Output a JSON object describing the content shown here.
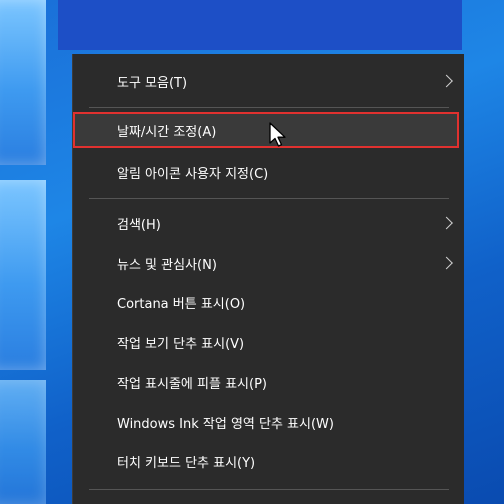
{
  "context_menu": {
    "items": [
      {
        "label": "도구 모음(T)",
        "has_submenu": true
      },
      {
        "label": "날짜/시간 조정(A)",
        "highlighted": true
      },
      {
        "label": "알림 아이콘 사용자 지정(C)"
      },
      {
        "label": "검색(H)",
        "has_submenu": true
      },
      {
        "label": "뉴스 및 관심사(N)",
        "has_submenu": true
      },
      {
        "label": "Cortana 버튼 표시(O)"
      },
      {
        "label": "작업 보기 단추 표시(V)"
      },
      {
        "label": "작업 표시줄에 피플 표시(P)"
      },
      {
        "label": "Windows Ink 작업 영역 단추 표시(W)"
      },
      {
        "label": "터치 키보드 단추 표시(Y)"
      }
    ]
  },
  "colors": {
    "menu_background": "#2b2b2b",
    "highlight_border": "#e0312f",
    "desktop_accent": "#1d4fc6"
  }
}
